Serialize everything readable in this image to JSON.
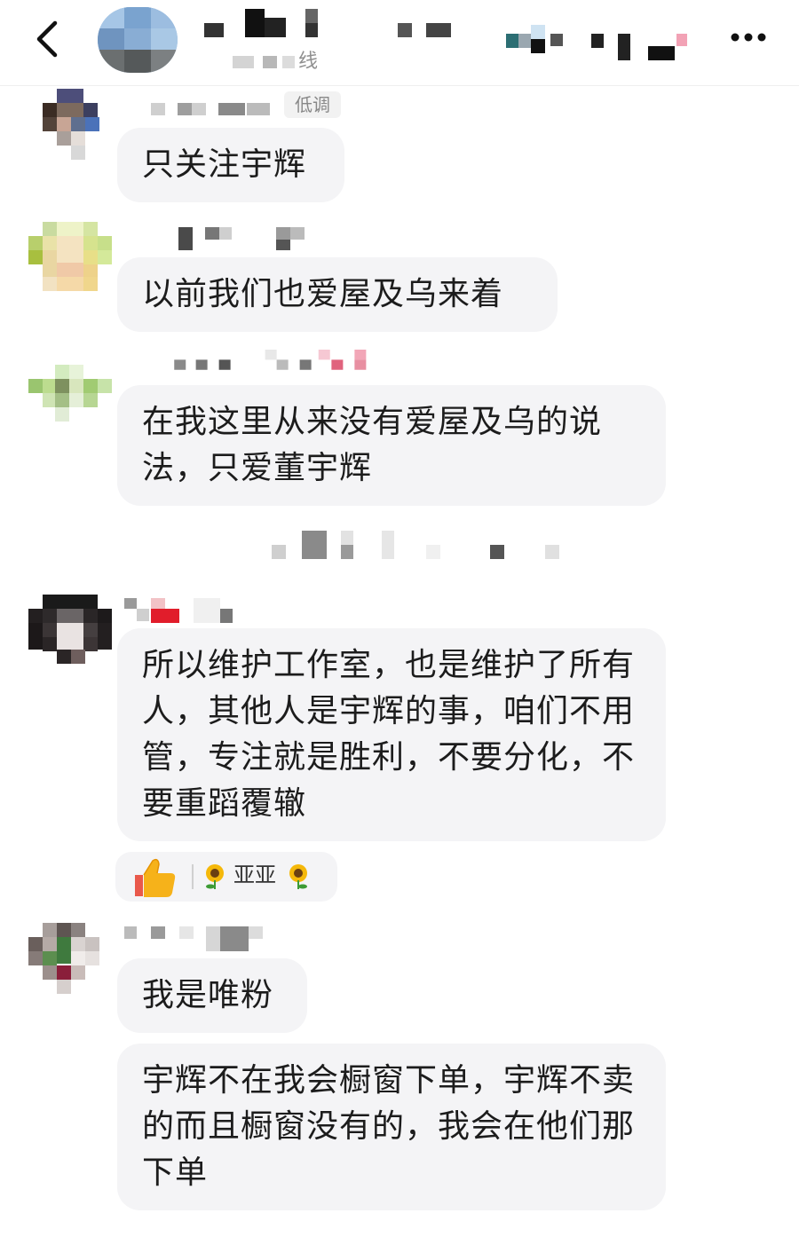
{
  "header": {
    "status_text": "线"
  },
  "messages": [
    {
      "role_badge": "低调",
      "text": "只关注宇辉"
    },
    {
      "text": "以前我们也爱屋及乌来着"
    },
    {
      "text": "在我这里从来没有爱屋及乌的说法，只爱董宇辉"
    },
    {
      "text": "所以维护工作室，也是维护了所有人，其他人是宇辉的事，咱们不用管，专注就是胜利，不要分化，不要重蹈覆辙"
    },
    {
      "text": "我是唯粉"
    },
    {
      "text": "宇辉不在我会橱窗下单，宇辉不卖的而且橱窗没有的，我会在他们那下单"
    }
  ],
  "reaction": {
    "user": "亚亚",
    "emoji": "thumbs-up-icon",
    "decoration": "sunflower-icon"
  },
  "colors": {
    "bubble": "#f4f4f6",
    "text": "#1c1c1c",
    "badge_text": "#888888"
  }
}
